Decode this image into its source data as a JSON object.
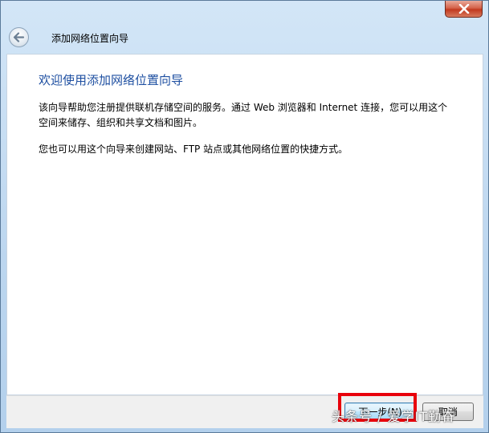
{
  "window": {
    "title": "添加网络位置向导",
    "close_icon": "close-icon",
    "back_icon": "back-arrow-icon"
  },
  "content": {
    "heading": "欢迎使用添加网络位置向导",
    "para1": "该向导帮助您注册提供联机存储空间的服务。通过 Web 浏览器和 Internet 连接，您可以用这个空间来储存、组织和共享文档和图片。",
    "para2": "您也可以用这个向导来创建网站、FTP 站点或其他网络位置的快捷方式。"
  },
  "footer": {
    "next_label": "下一步(N)",
    "cancel_label": "取消"
  },
  "watermark": "头条号 / 爱学IT勤奋",
  "colors": {
    "heading": "#1e4fa1",
    "highlight": "#e8000b",
    "close_button": "#c2391e"
  }
}
